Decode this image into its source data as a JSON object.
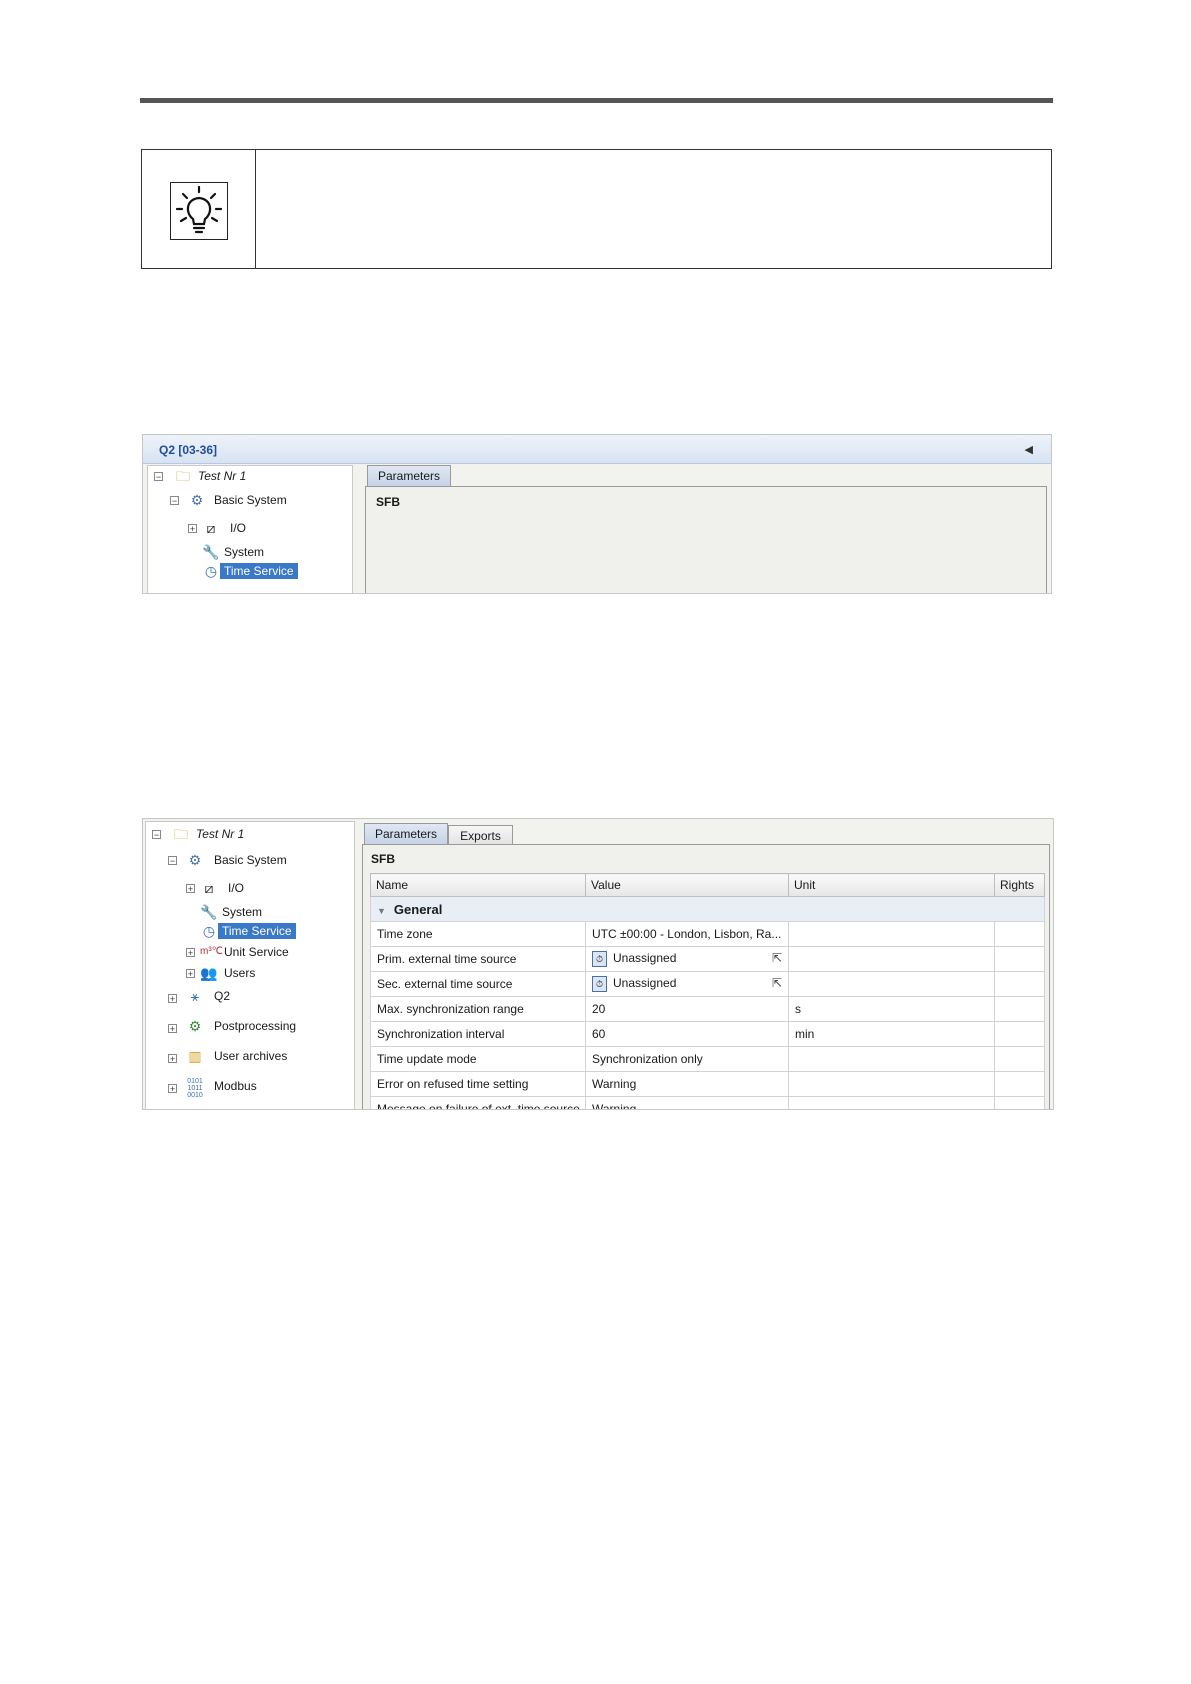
{
  "doc": {
    "tip_icon": "lightbulb-icon"
  },
  "shot1": {
    "title": "Q2 [03-36]",
    "collapse_icon": "triangle-left-icon",
    "tree": {
      "root": "Test Nr 1",
      "basic": "Basic System",
      "io": "I/O",
      "system": "System",
      "time": "Time Service"
    },
    "tab": "Parameters",
    "section": "SFB"
  },
  "shot2": {
    "tree": {
      "root": "Test Nr 1",
      "basic": "Basic System",
      "io": "I/O",
      "system": "System",
      "time": "Time Service",
      "unit": "Unit Service",
      "users": "Users",
      "q2": "Q2",
      "post": "Postprocessing",
      "archives": "User archives",
      "modbus": "Modbus"
    },
    "tabs": [
      "Parameters",
      "Exports"
    ],
    "section": "SFB",
    "columns": [
      "Name",
      "Value",
      "Unit",
      "Rights"
    ],
    "group": "General",
    "rows": [
      {
        "name": "Time zone",
        "value": "UTC ±00:00 - London, Lisbon, Ra...",
        "unit": ""
      },
      {
        "name": "Prim. external time source",
        "value": "Unassigned",
        "unit": ""
      },
      {
        "name": "Sec. external time source",
        "value": "Unassigned",
        "unit": ""
      },
      {
        "name": "Max. synchronization range",
        "value": "20",
        "unit": "s"
      },
      {
        "name": "Synchronization interval",
        "value": "60",
        "unit": "min"
      },
      {
        "name": "Time update mode",
        "value": "Synchronization only",
        "unit": ""
      },
      {
        "name": "Error on refused time setting",
        "value": "Warning",
        "unit": ""
      },
      {
        "name": "Message on failure of ext. time source",
        "value": "Warning",
        "unit": ""
      }
    ]
  }
}
